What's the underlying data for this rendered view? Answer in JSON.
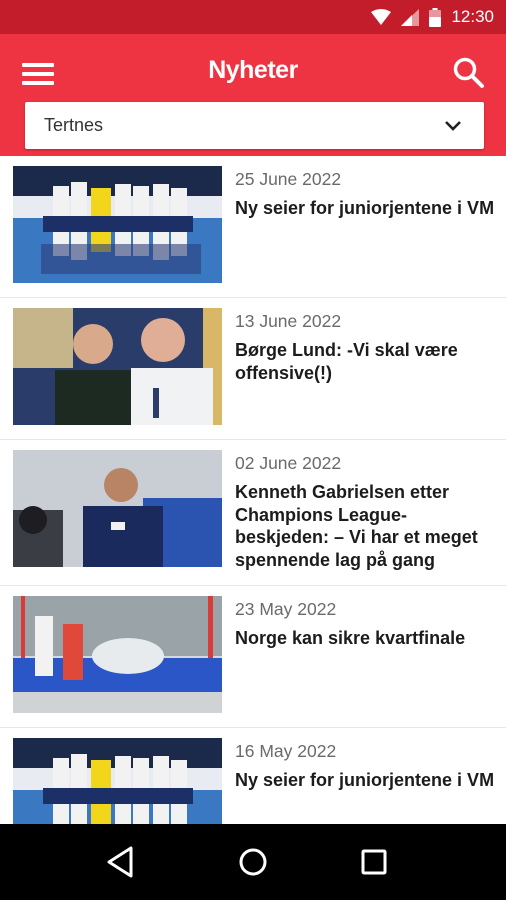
{
  "status_bar": {
    "time": "12:30"
  },
  "app_bar": {
    "title": "Nyheter",
    "menu_icon": "hamburger-menu-icon",
    "search_icon": "search-icon",
    "accent_color": "#ee3343",
    "status_color": "#c31d2c"
  },
  "filter": {
    "selected": "Tertnes"
  },
  "news": [
    {
      "date": "25 June 2022",
      "title": "Ny seier for juniorjentene i VM"
    },
    {
      "date": "13 June 2022",
      "title": "Børge Lund: -Vi skal være offensive(!)"
    },
    {
      "date": "02 June 2022",
      "title": "Kenneth Gabrielsen etter Champions League-beskjeden: – Vi har et meget spennende lag på gang"
    },
    {
      "date": "23 May 2022",
      "title": "Norge kan sikre kvartfinale"
    },
    {
      "date": "16 May 2022",
      "title": "Ny seier for juniorjentene i VM"
    }
  ],
  "nav_bar": {
    "back_icon": "back-triangle-icon",
    "home_icon": "home-circle-icon",
    "recents_icon": "recents-square-icon"
  }
}
